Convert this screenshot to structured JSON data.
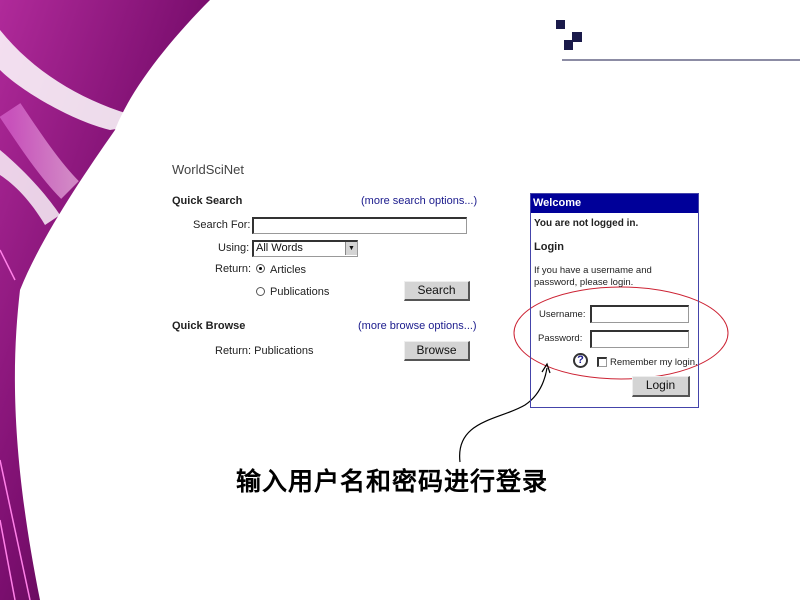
{
  "site_title": "WorldSciNet",
  "quick_search": {
    "heading": "Quick Search",
    "more_link": "(more search options...)",
    "search_for_label": "Search For:",
    "search_for_value": "",
    "using_label": "Using:",
    "using_value": "All Words",
    "return_label": "Return:",
    "options": [
      {
        "label": "Articles",
        "selected": true
      },
      {
        "label": "Publications",
        "selected": false
      }
    ],
    "search_button": "Search"
  },
  "quick_browse": {
    "heading": "Quick Browse",
    "more_link": "(more browse options...)",
    "return_text": "Return: Publications",
    "browse_button": "Browse"
  },
  "login_panel": {
    "header": "Welcome",
    "status": "You are not logged in.",
    "heading": "Login",
    "instructions_line1": "If you have a username and",
    "instructions_line2": "password, please login.",
    "username_label": "Username:",
    "username_value": "",
    "password_label": "Password:",
    "password_value": "",
    "help_icon": "question-magnifier-icon",
    "remember_label": "Remember my login.",
    "remember_checked": false,
    "login_button": "Login",
    "header_color": "#000099"
  },
  "annotation": {
    "caption": "输入用户名和密码进行登录",
    "highlight_color": "#cc2233"
  }
}
